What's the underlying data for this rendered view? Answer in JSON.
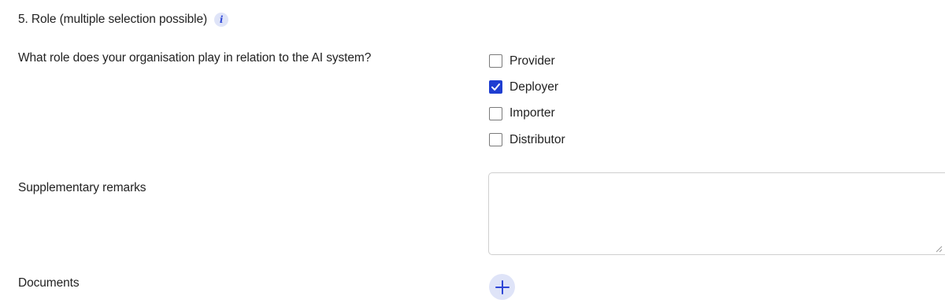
{
  "section": {
    "title": "5. Role (multiple selection possible)",
    "info_icon": "info-icon",
    "info_glyph": "i"
  },
  "role_question": {
    "label": "What role does your organisation play in relation to the AI system?",
    "options": [
      {
        "label": "Provider",
        "checked": false
      },
      {
        "label": "Deployer",
        "checked": true
      },
      {
        "label": "Importer",
        "checked": false
      },
      {
        "label": "Distributor",
        "checked": false
      }
    ]
  },
  "remarks": {
    "label": "Supplementary remarks",
    "value": ""
  },
  "documents": {
    "label": "Documents",
    "add_icon": "plus-icon"
  },
  "colors": {
    "accent": "#1f3ed1",
    "accent_soft": "#dfe4f8",
    "text": "#222222",
    "border": "#cfcfcf"
  }
}
